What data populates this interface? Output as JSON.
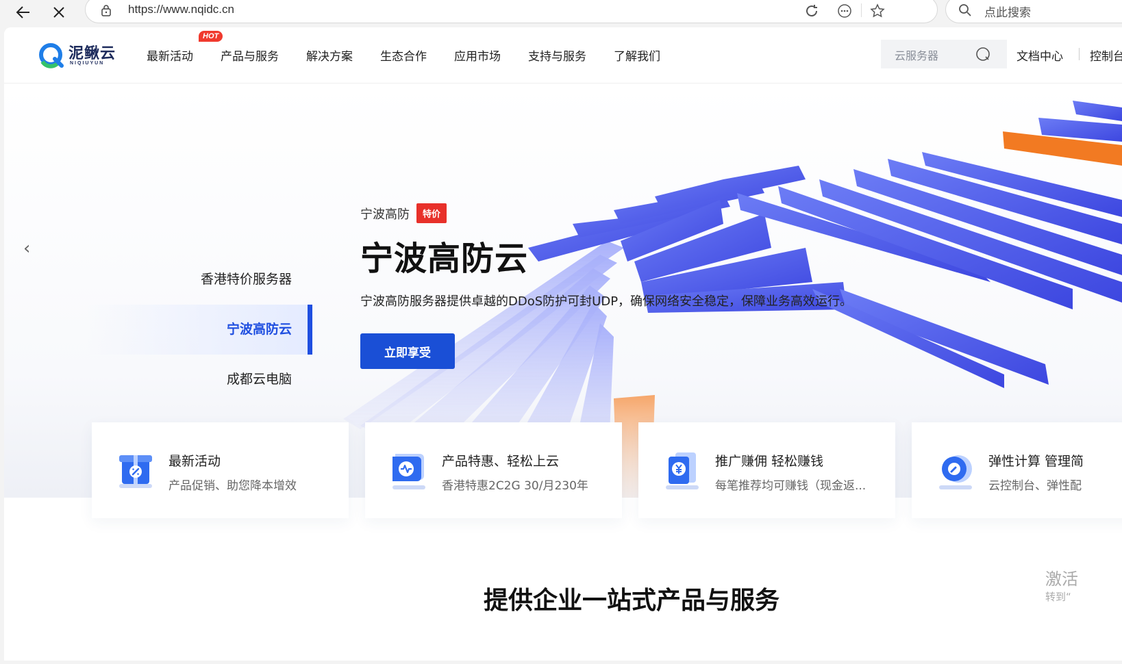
{
  "browser": {
    "url": "https://www.nqidc.cn",
    "search_placeholder": "点此搜索"
  },
  "header": {
    "logo_text": "泥鳅云",
    "logo_sub": "NIQIUYUN",
    "nav": [
      {
        "label": "最新活动",
        "badge": "HOT"
      },
      {
        "label": "产品与服务"
      },
      {
        "label": "解决方案"
      },
      {
        "label": "生态合作"
      },
      {
        "label": "应用市场"
      },
      {
        "label": "支持与服务"
      },
      {
        "label": "了解我们"
      }
    ],
    "search_placeholder": "云服务器",
    "docs_link": "文档中心",
    "console_link": "控制台"
  },
  "hero": {
    "tabs": [
      "香港特价服务器",
      "宁波高防云",
      "成都云电脑"
    ],
    "active_tab": 1,
    "eyebrow": "宁波高防",
    "tag": "特价",
    "title": "宁波高防云",
    "description": "宁波高防服务器提供卓越的DDoS防护可封UDP，确保网络安全稳定，保障业务高效运行。",
    "cta": "立即享受",
    "slides_count": 3
  },
  "cards": [
    {
      "title": "最新活动",
      "sub": "产品促销、助您降本增效",
      "icon": "gift-icon"
    },
    {
      "title": "产品特惠、轻松上云",
      "sub": "香港特惠2C2G 30/月230年",
      "icon": "monitor-icon"
    },
    {
      "title": "推广赚佣 轻松赚钱",
      "sub": "每笔推荐均可赚钱（现金返...",
      "icon": "yuan-doc-icon"
    },
    {
      "title": "弹性计算 管理简",
      "sub": "云控制台、弹性配",
      "icon": "gear-wrench-icon"
    }
  ],
  "section_title": "提供企业一站式产品与服务",
  "watermark": {
    "line1": "激活",
    "line2": "转到“"
  },
  "colors": {
    "primary": "#1a4fd6",
    "hot": "#f03a2e",
    "tag": "#e8302a"
  }
}
